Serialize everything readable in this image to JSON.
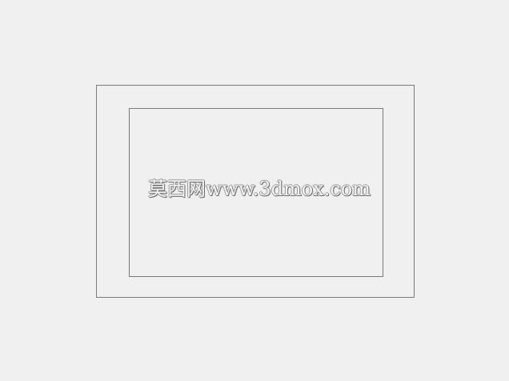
{
  "watermark": {
    "text": "莫西网www.3dmox.com"
  },
  "colors": {
    "background": "#f0f0f0",
    "frame_border": "#7a7a7a"
  }
}
